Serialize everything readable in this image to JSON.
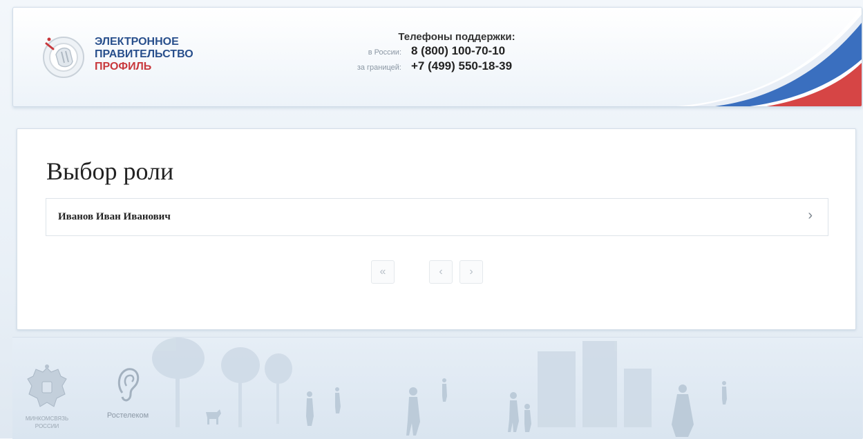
{
  "header": {
    "logo": {
      "line1": "ЭЛЕКТРОННОЕ",
      "line2": "ПРАВИТЕЛЬСТВО",
      "line3": "ПРОФИЛЬ"
    },
    "support": {
      "title": "Телефоны поддержки:",
      "russia_label": "в России:",
      "russia_number": "8 (800) 100-70-10",
      "abroad_label": "за границей:",
      "abroad_number": "+7 (499) 550-18-39"
    }
  },
  "main": {
    "title": "Выбор роли",
    "roles": [
      {
        "name": "Иванов Иван Иванович",
        "arrow": "›"
      }
    ],
    "pagination": {
      "first": "«",
      "prev": "‹",
      "next": "›"
    }
  },
  "footer": {
    "ministry_label_1": "МИНКОМСВЯЗЬ",
    "ministry_label_2": "РОССИИ",
    "rostelecom_label": "Ростелеком"
  },
  "colors": {
    "brand_blue": "#284f8c",
    "brand_red": "#c8383c",
    "flag_blue": "#2a5aa8",
    "flag_red": "#d23a3a"
  }
}
